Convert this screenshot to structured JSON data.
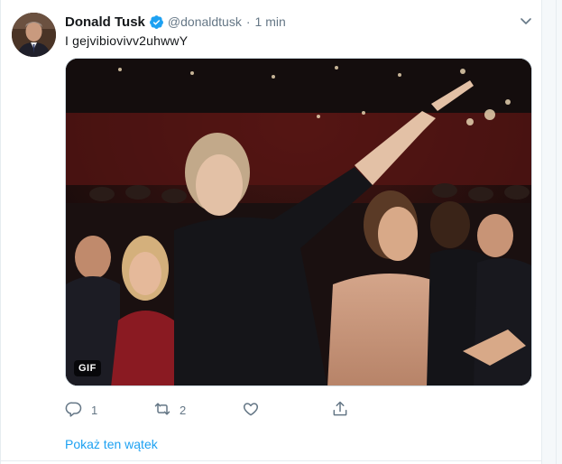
{
  "tweet": {
    "author_name": "Donald Tusk",
    "author_handle": "@donaldtusk",
    "separator": "·",
    "time": "1 min",
    "text": "I gejvibiovivv2uhwwY",
    "media": {
      "badge": "GIF"
    },
    "actions": {
      "reply_count": "1",
      "retweet_count": "2",
      "like_count": "",
      "share_count": ""
    },
    "show_thread": "Pokaż ten wątek"
  },
  "icons": {
    "avatar": "avatar",
    "verified": "verified-badge-icon",
    "more": "chevron-down-icon",
    "reply": "reply-icon",
    "retweet": "retweet-icon",
    "like": "heart-icon",
    "share": "share-icon"
  },
  "colors": {
    "accent": "#1da1f2",
    "text_primary": "#14171a",
    "text_secondary": "#657786",
    "border": "#e6ecf0"
  }
}
